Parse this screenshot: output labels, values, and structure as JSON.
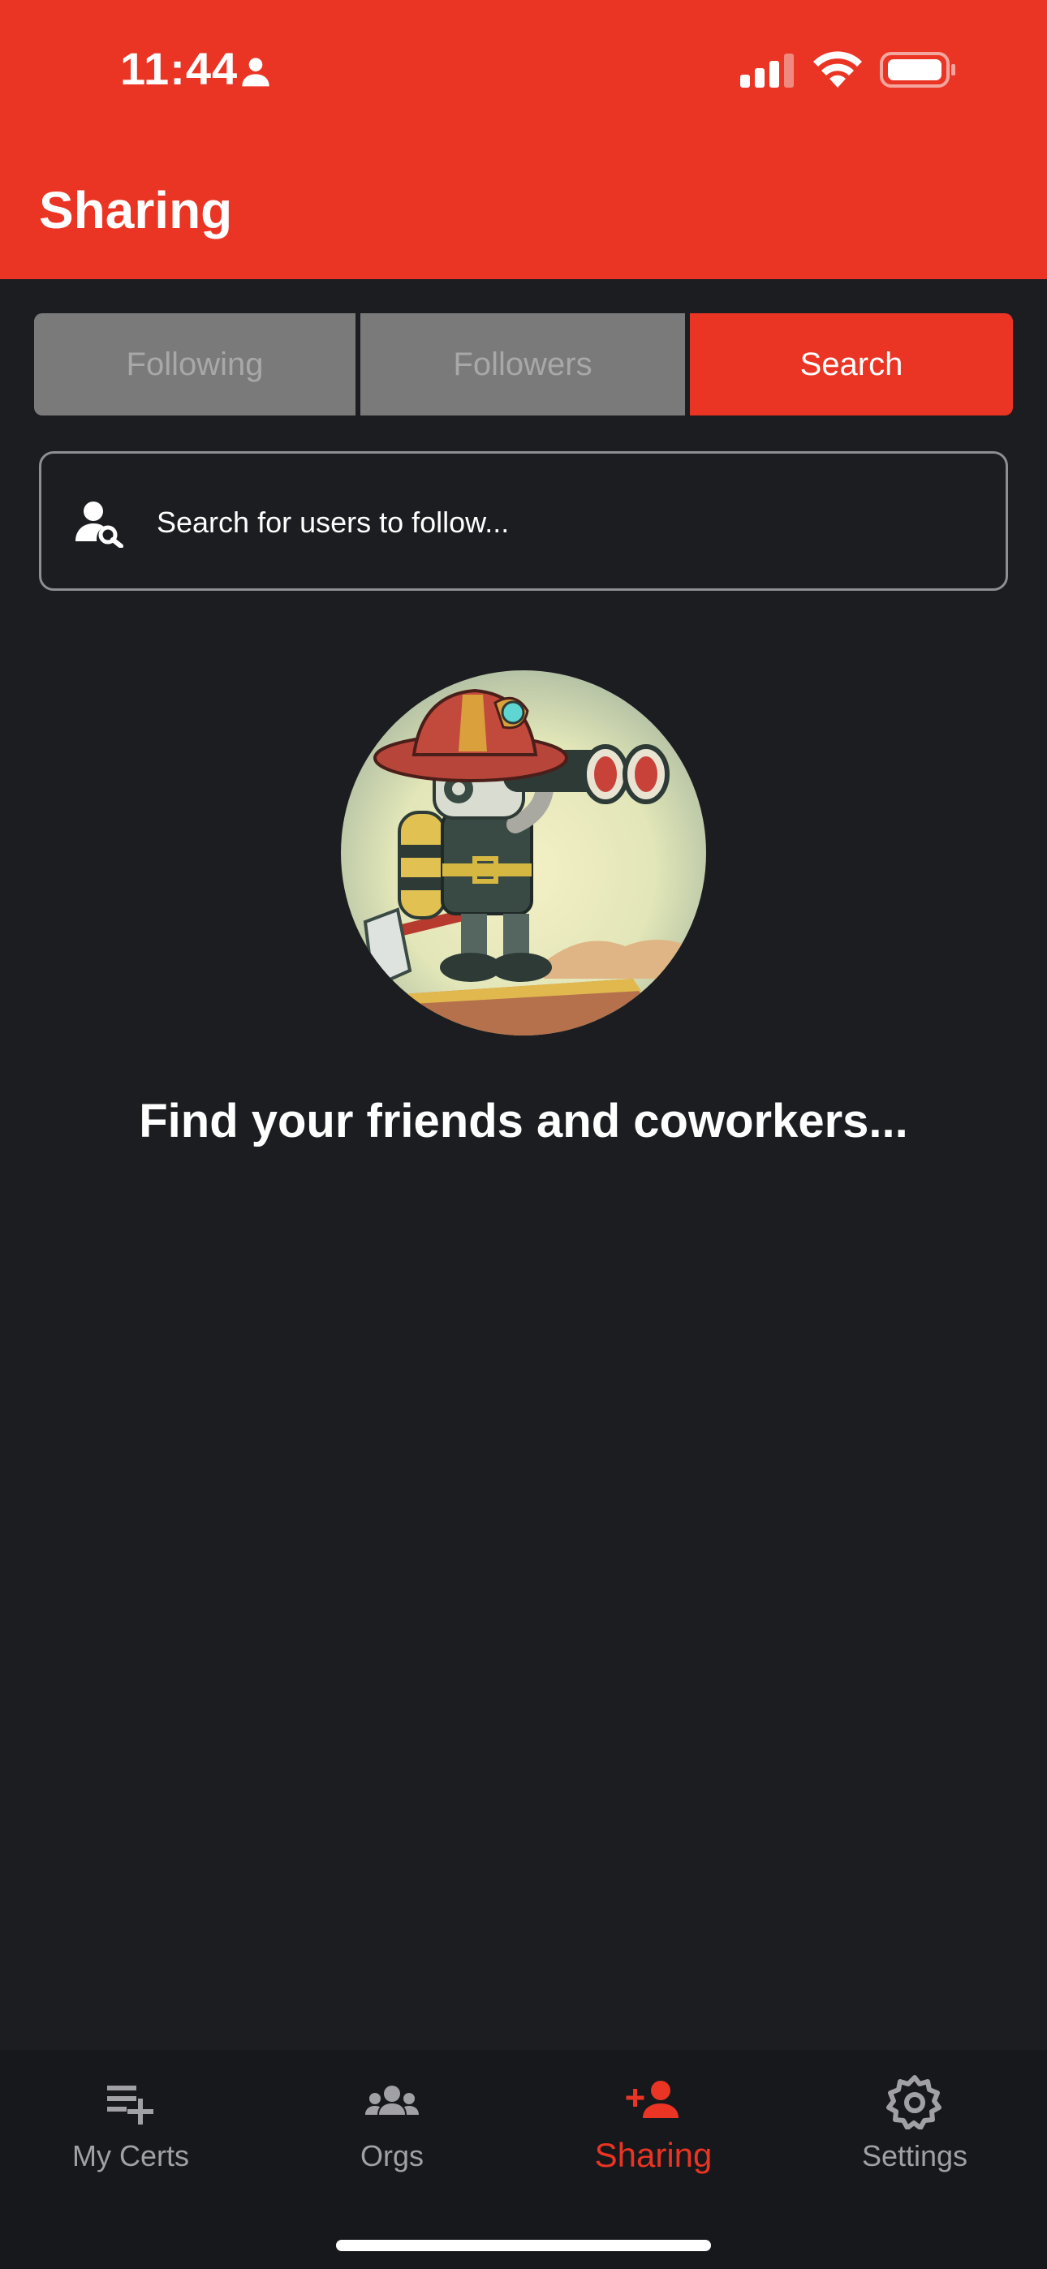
{
  "status_bar": {
    "time": "11:44"
  },
  "header": {
    "title": "Sharing",
    "accent_color": "#ea3424"
  },
  "tabs": [
    {
      "label": "Following",
      "selected": false
    },
    {
      "label": "Followers",
      "selected": false
    },
    {
      "label": "Search",
      "selected": true
    }
  ],
  "search": {
    "placeholder": "Search for users to follow...",
    "value": "",
    "icon": "user-search-icon"
  },
  "empty_state": {
    "message": "Find your friends and coworkers...",
    "image": "firefighter-robot-binoculars-illustration"
  },
  "bottom_nav": {
    "items": [
      {
        "label": "My Certs",
        "icon": "playlist-add-icon",
        "active": false
      },
      {
        "label": "Orgs",
        "icon": "group-icon",
        "active": false
      },
      {
        "label": "Sharing",
        "icon": "person-add-icon",
        "active": true
      },
      {
        "label": "Settings",
        "icon": "gear-icon",
        "active": false
      }
    ]
  }
}
